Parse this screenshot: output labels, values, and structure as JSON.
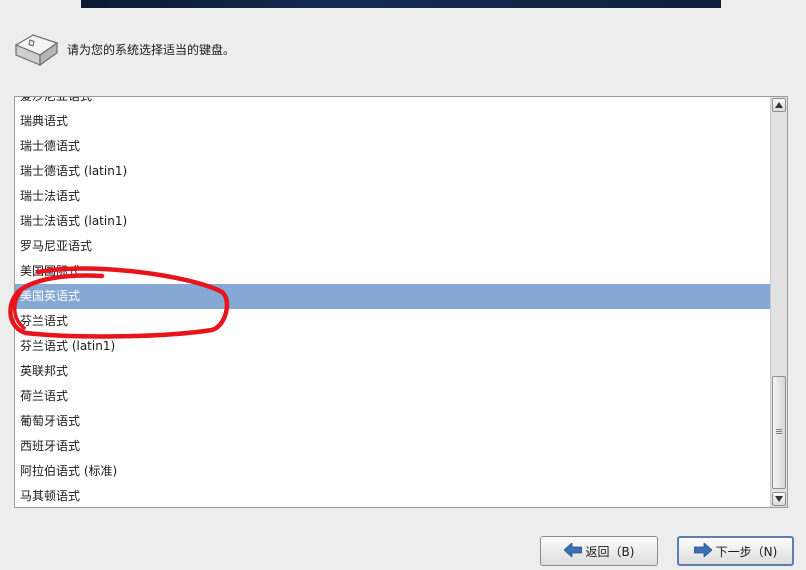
{
  "header": {
    "prompt": "请为您的系统选择适当的键盘。",
    "icon": "keyboard-key-icon"
  },
  "keyboard_list": {
    "items": [
      {
        "label": "爱沙尼亚语式",
        "selected": false
      },
      {
        "label": "瑞典语式",
        "selected": false
      },
      {
        "label": "瑞士德语式",
        "selected": false
      },
      {
        "label": "瑞士德语式 (latin1)",
        "selected": false
      },
      {
        "label": "瑞士法语式",
        "selected": false
      },
      {
        "label": "瑞士法语式 (latin1)",
        "selected": false
      },
      {
        "label": "罗马尼亚语式",
        "selected": false
      },
      {
        "label": "美国国际式",
        "selected": false
      },
      {
        "label": "美国英语式",
        "selected": true
      },
      {
        "label": "芬兰语式",
        "selected": false
      },
      {
        "label": "芬兰语式 (latin1)",
        "selected": false
      },
      {
        "label": "英联邦式",
        "selected": false
      },
      {
        "label": "荷兰语式",
        "selected": false
      },
      {
        "label": "葡萄牙语式",
        "selected": false
      },
      {
        "label": "西班牙语式",
        "selected": false
      },
      {
        "label": "阿拉伯语式 (标准)",
        "selected": false
      },
      {
        "label": "马其顿语式",
        "selected": false
      }
    ],
    "scroll_position": 0.87
  },
  "buttons": {
    "back_label": "返回（B)",
    "next_label": "下一步（N)",
    "back_icon": "arrow-left-icon",
    "next_icon": "arrow-right-icon"
  },
  "colors": {
    "selection": "#86a8d4",
    "annotation": "#e8141c",
    "banner": "#142a52"
  }
}
